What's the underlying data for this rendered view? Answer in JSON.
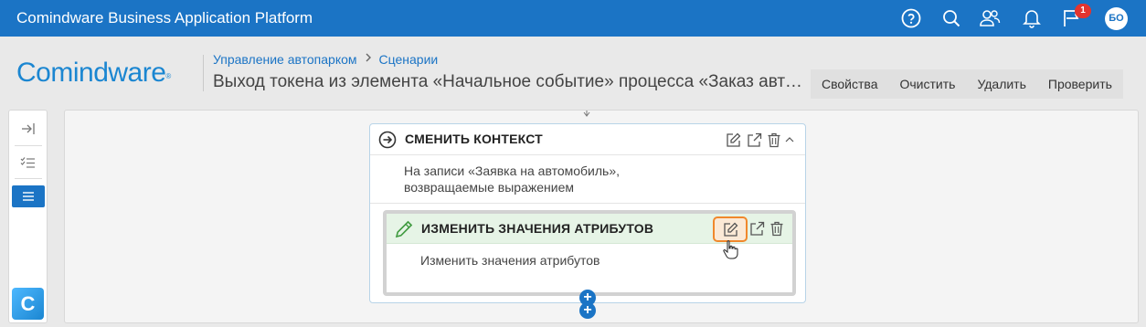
{
  "app": {
    "title": "Comindware Business Application Platform",
    "notification_count": "1",
    "avatar_initials": "БО"
  },
  "icons": {
    "help": "help-circle-icon",
    "search": "search-icon",
    "users": "users-icon",
    "bell": "bell-icon",
    "messages": "flag-message-icon"
  },
  "header": {
    "logo": "Comindware",
    "logo_mark": "®",
    "breadcrumb": [
      "Управление автопарком",
      "Сценарии"
    ],
    "title": "Выход токена из элемента «Начальное событие» процесса «Заказ автомобиля»",
    "toolbar": [
      "Свойства",
      "Очистить",
      "Удалить",
      "Проверить"
    ]
  },
  "rail": {
    "badge": "C"
  },
  "canvas": {
    "block": {
      "title": "СМЕНИТЬ КОНТЕКСТ",
      "desc_line1": "На записи «Заявка на автомобиль»,",
      "desc_line2": "возвращаемые выражением"
    },
    "inner": {
      "title": "ИЗМЕНИТЬ ЗНАЧЕНИЯ АТРИБУТОВ",
      "desc": "Изменить значения атрибутов"
    },
    "add_symbol": "+"
  },
  "colors": {
    "topbar": "#1b74c5",
    "accent_highlight": "#f0882c",
    "inner_header": "#e6f4e6"
  }
}
